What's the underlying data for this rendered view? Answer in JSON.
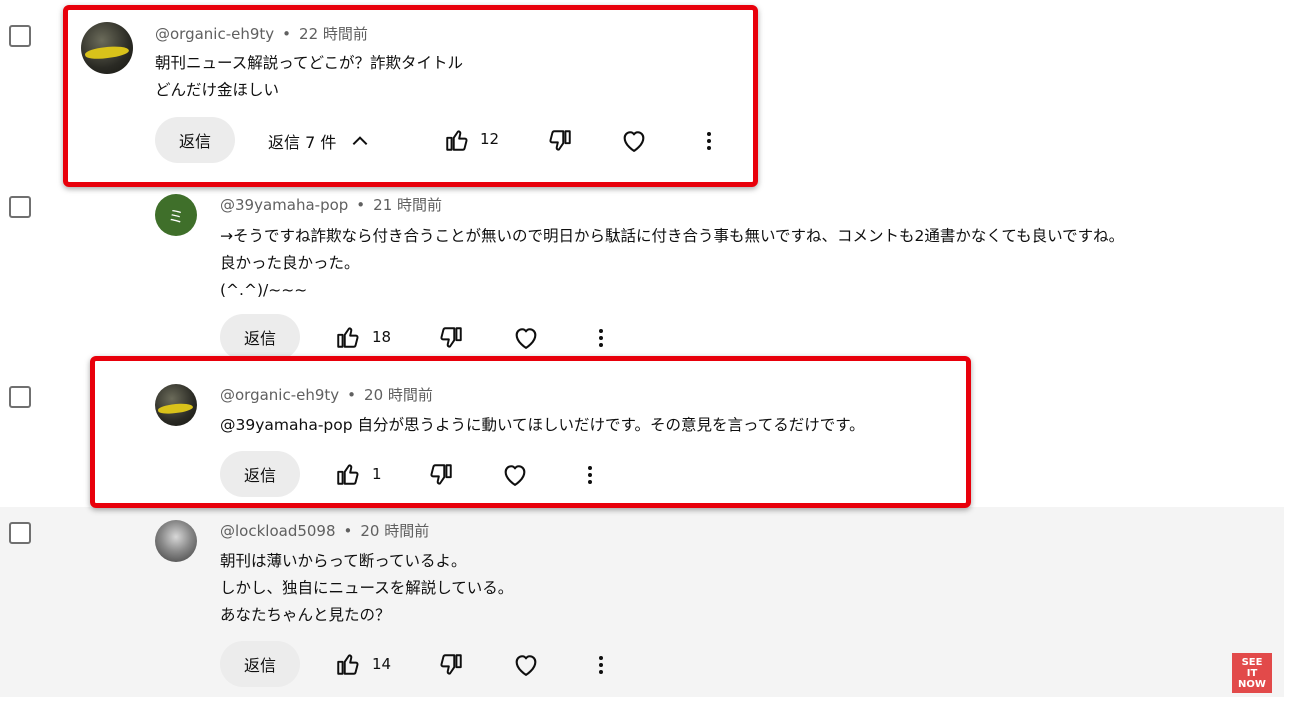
{
  "comments": [
    {
      "handle": "@organic-eh9ty",
      "time": "22 時間前",
      "lines": [
        "朝刊ニュース解説ってどこが？詐欺タイトル",
        "どんだけ金ほしい"
      ],
      "reply_label": "返信",
      "replies_label": "返信 7 件",
      "likes": "12"
    },
    {
      "handle": "@39yamaha-pop",
      "time": "21 時間前",
      "avatar_letter": "ミ",
      "lines": [
        "→そうですね詐欺なら付き合うことが無いので明日から駄話に付き合う事も無いですね、コメントも2通書かなくても良いですね。",
        "良かった良かった。",
        "(^.^)/~~~"
      ],
      "reply_label": "返信",
      "likes": "18"
    },
    {
      "handle": "@organic-eh9ty",
      "time": "20 時間前",
      "lines": [
        "@39yamaha-pop 自分が思うように動いてほしいだけです。その意見を言ってるだけです。"
      ],
      "reply_label": "返信",
      "likes": "1"
    },
    {
      "handle": "@lockload5098",
      "time": "20 時間前",
      "lines": [
        "朝刊は薄いからって断っているよ。",
        "しかし、独自にニュースを解説している。",
        "あなたちゃんと見たの？"
      ],
      "reply_label": "返信",
      "likes": "14"
    }
  ],
  "separator": "•",
  "badge": [
    "SEE",
    "IT",
    "NOW"
  ],
  "colors": {
    "highlight": "#e8000b",
    "meta": "#606060",
    "badge": "#e24a4a"
  }
}
